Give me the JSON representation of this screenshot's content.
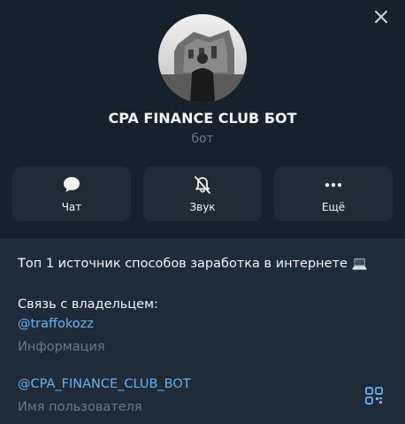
{
  "header": {
    "name": "CPA FINANCE CLUB БОТ",
    "subtitle": "бот",
    "close_icon": "close-icon"
  },
  "actions": [
    {
      "label": "Чат",
      "icon": "chat-bubble-icon"
    },
    {
      "label": "Звук",
      "icon": "bell-muted-icon"
    },
    {
      "label": "Ещё",
      "icon": "more-dots-icon"
    }
  ],
  "info": {
    "description": "Топ 1 источник способов заработка в интернете 💻",
    "contact_label": "Связь с владельцем:",
    "contact_link": "@traffokozz",
    "info_label": "Информация",
    "username": "@CPA_FINANCE_CLUB_BOT",
    "username_label": "Имя пользователя",
    "qr_icon": "qr-code-icon"
  },
  "colors": {
    "background": "#17212b",
    "info_background": "#1e2c3a",
    "button_background": "#202b36",
    "link": "#6ab2f2",
    "muted_text": "#6d7883"
  }
}
